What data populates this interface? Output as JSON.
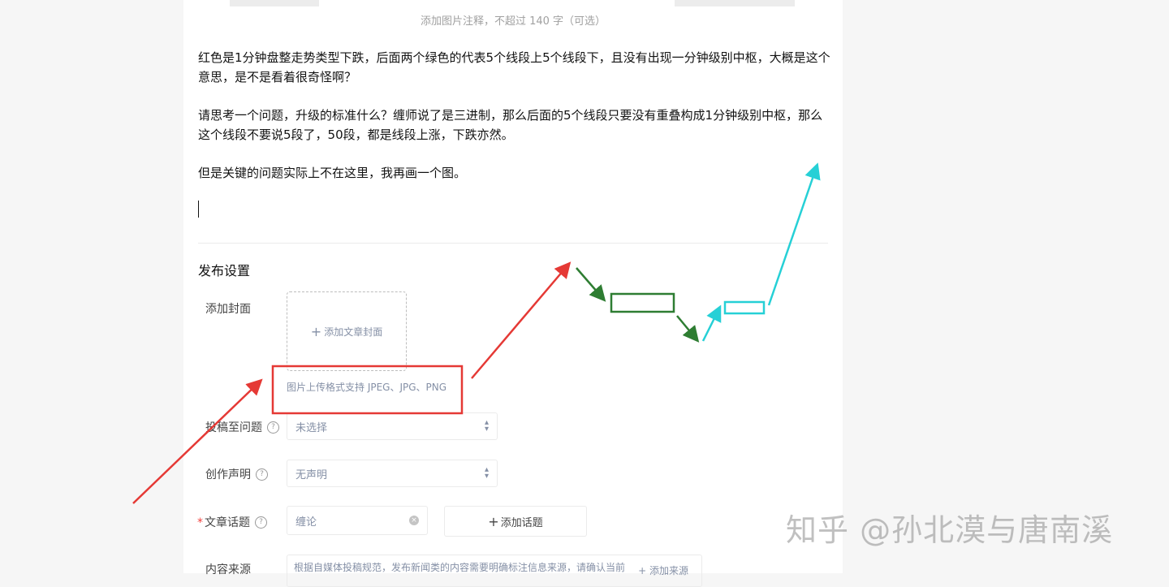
{
  "image_caption": "添加图片注释，不超过 140 字（可选）",
  "paragraphs": [
    "红色是1分钟盘整走势类型下跌，后面两个绿色的代表5个线段上5个线段下，且没有出现一分钟级别中枢，大概是这个意思，是不是看着很奇怪啊？",
    "请思考一个问题，升级的标准什么？缠师说了是三进制，那么后面的5个线段只要没有重叠构成1分钟级别中枢，那么这个线段不要说5段了，50段，都是线段上涨，下跌亦然。",
    "但是关键的问题实际上不在这里，我再画一个图。"
  ],
  "publish": {
    "title": "发布设置",
    "cover_label": "添加封面",
    "cover_button": "添加文章封面",
    "cover_hint": "图片上传格式支持 JPEG、JPG、PNG",
    "question_label": "投稿至问题",
    "question_value": "未选择",
    "statement_label": "创作声明",
    "statement_value": "无声明",
    "topic_required": "*",
    "topic_label": "文章话题",
    "topic_value": "缠论",
    "add_topic": "添加话题",
    "source_label": "内容来源",
    "source_hint": "根据自媒体投稿规范，发布新闻类的内容需要明确标注信息来源，请确认当前",
    "source_add": "添加来源"
  },
  "watermark": "知乎 @孙北漠与唐南溪",
  "colors": {
    "red_annotation": "#e53935",
    "green_annotation": "#2e7d32",
    "cyan_annotation": "#26d0d6"
  }
}
